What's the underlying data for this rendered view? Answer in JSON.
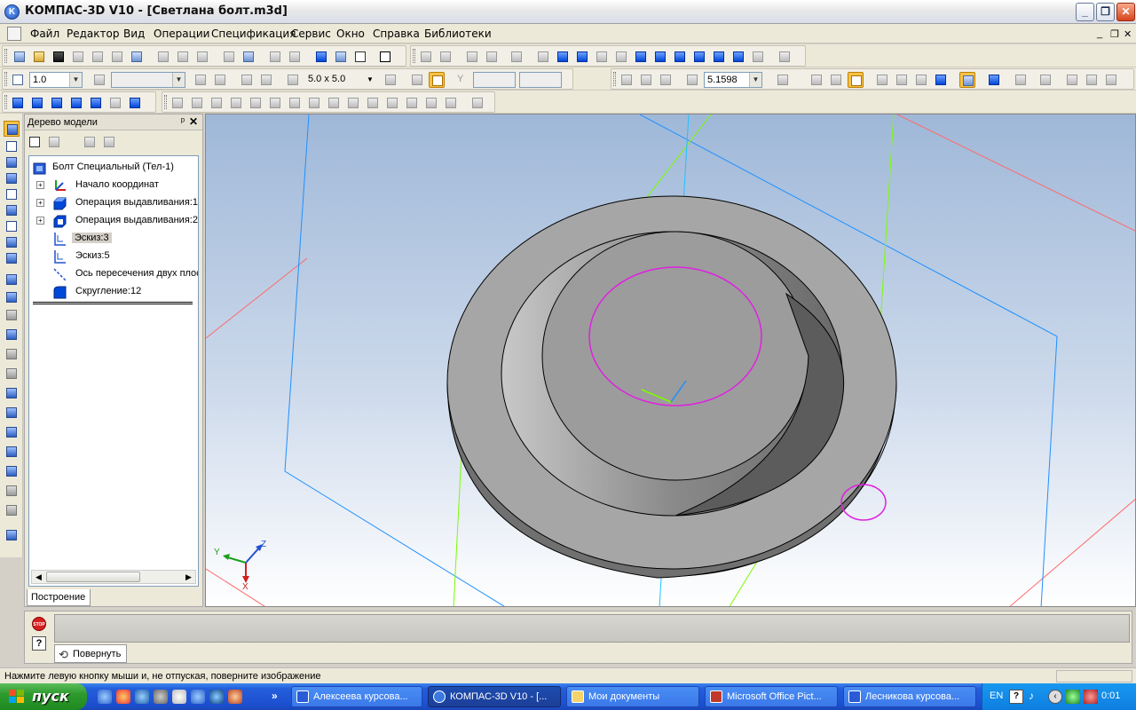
{
  "window": {
    "app_icon": "kompas-icon",
    "title": "КОМПАС-3D V10 - [Светлана болт.m3d]",
    "min_label": "_",
    "max_label": "❐",
    "close_label": "✕"
  },
  "menu": {
    "items": [
      "Файл",
      "Редактор",
      "Вид",
      "Операции",
      "Спецификация",
      "Сервис",
      "Окно",
      "Справка",
      "Библиотеки"
    ],
    "mdi_controls": [
      "_",
      "❐",
      "✕"
    ]
  },
  "toolbar2": {
    "line_width": "1.0",
    "grid_size": "5.0 x 5.0",
    "zoom_value": "5.1598",
    "coord_label": "Y"
  },
  "tree": {
    "header": "Дерево модели",
    "pin_label": "ᵖ",
    "close_label": "✕",
    "items": [
      {
        "label": "Болт Специальный (Тел-1)",
        "icon": "part-icon",
        "expandable": false
      },
      {
        "label": "Начало координат",
        "icon": "origin-icon",
        "expandable": true
      },
      {
        "label": "Операция выдавливания:1",
        "icon": "extrude-icon",
        "expandable": true
      },
      {
        "label": "Операция выдавливания:2",
        "icon": "extrude-icon",
        "expandable": true
      },
      {
        "label": "Эскиз:3",
        "icon": "sketch-icon",
        "expandable": false,
        "selected": true
      },
      {
        "label": "Эскиз:5",
        "icon": "sketch-icon",
        "expandable": false
      },
      {
        "label": "Ось пересечения двух плоскостей",
        "icon": "axis-icon",
        "expandable": false
      },
      {
        "label": "Скругление:12",
        "icon": "fillet-icon",
        "expandable": false
      }
    ],
    "tab_label": "Построение",
    "expander_symbol": "+"
  },
  "viewport": {
    "axes": {
      "x": "X",
      "y": "Y",
      "z": "Z"
    }
  },
  "property_panel": {
    "stop_label": "STOP",
    "help_label": "?",
    "tab_label": "Повернуть"
  },
  "status": {
    "text": "Нажмите левую кнопку мыши и, не отпуская, поверните изображение"
  },
  "taskbar": {
    "start_label": "пуск",
    "quicklaunch_more": "»",
    "buttons": [
      {
        "label": "Алексеева курсова...",
        "active": false,
        "color": "#2a5bd7"
      },
      {
        "label": "КОМПАС-3D V10 - [...",
        "active": true,
        "color": "#3a7adf"
      },
      {
        "label": "Мои документы",
        "active": false,
        "color": "#f3d36a"
      },
      {
        "label": "Microsoft Office Pict...",
        "active": false,
        "color": "#c0392b"
      },
      {
        "label": "Лесникова курсова...",
        "active": false,
        "color": "#2a5bd7"
      }
    ],
    "lang": "EN",
    "clock": "0:01"
  },
  "colors": {
    "accent": "#245edb",
    "selection": "#f6c24a",
    "plane_blue": "#1e90ff",
    "plane_green": "#7cfc00",
    "plane_red": "#ff6a6a",
    "sketch_magenta": "#e020e0"
  }
}
